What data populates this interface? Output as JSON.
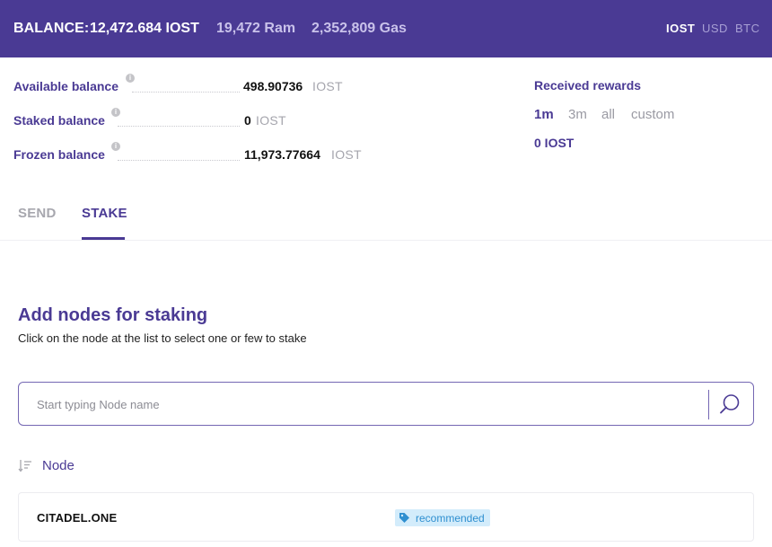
{
  "header": {
    "balance_label": "BALANCE:",
    "balance_value": "12,472.684 IOST",
    "ram": "19,472 Ram",
    "gas": "2,352,809 Gas",
    "currencies": [
      "IOST",
      "USD",
      "BTC"
    ],
    "active_currency": "IOST"
  },
  "balances": [
    {
      "label": "Available balance",
      "value": "498.90736",
      "unit": "IOST"
    },
    {
      "label": "Staked balance",
      "value": "0",
      "unit": "IOST"
    },
    {
      "label": "Frozen balance",
      "value": "11,973.77664",
      "unit": "IOST"
    }
  ],
  "info_icon": "i",
  "rewards": {
    "title": "Received rewards",
    "periods": [
      "1m",
      "3m",
      "all",
      "custom"
    ],
    "active_period": "1m",
    "value": "0 IOST"
  },
  "tabs": [
    {
      "label": "SEND",
      "active": false
    },
    {
      "label": "STAKE",
      "active": true
    }
  ],
  "stake": {
    "title": "Add nodes for staking",
    "subtitle": "Click on the node at the list to select one or few to stake",
    "search_placeholder": "Start typing Node name",
    "search_value": "",
    "column_header": "Node",
    "nodes": [
      {
        "name": "CITADEL.ONE",
        "badge": "recommended"
      }
    ]
  },
  "icons": {
    "info": "info-icon",
    "search": "search-icon",
    "sort": "sort-icon",
    "tag": "tag-icon"
  },
  "colors": {
    "brand": "#4a3a94",
    "muted": "#a7a7ae",
    "badge_bg": "#d3ecfb",
    "badge_text": "#2f8fd0"
  }
}
